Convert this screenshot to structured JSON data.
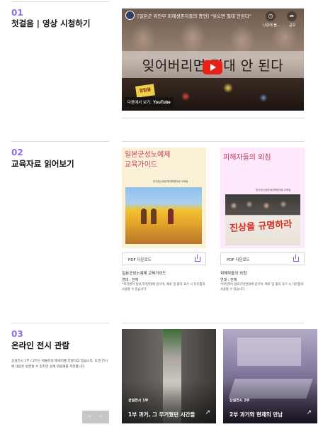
{
  "section1": {
    "number": "01",
    "title": "첫걸음 | 영상 시청하기",
    "video": {
      "title": "[일본군 위안부 피해생존자들의 증언] \"잊으면 절대 안된다\"",
      "overlay_text": "잊어버리면 절대 안 된다",
      "later_label": "나중에 볼...",
      "share_label": "공유",
      "watch_on": "다음에서 보기:",
      "youtube": "YouTube",
      "sign_text": "정말을"
    }
  },
  "section2": {
    "number": "02",
    "title": "교육자료 읽어보기",
    "books": [
      {
        "cover_title": "일본군성노예제\n교육가이드",
        "cover_sub": "한국정신대문제대책협의회 교육팀",
        "pdf_label": "PDF 다운로드",
        "name": "일본군성노예제 교육가이드",
        "meta": "연대 : 전체",
        "note": "*저작권이 정의기억연대에 있으며, 배포 및 출처 표기 시 자유롭게 사용할 수 있습니다."
      },
      {
        "cover_title": "피해자들의 외침",
        "cover_sub": "한국정신대문제대책협의회 교육팀",
        "pdf_label": "PDF 다운로드",
        "name": "피해자들의 외침",
        "meta": "연대 : 전체",
        "note": "*저작권이 정의기억연대에 있으며, 배포 및 출처 표기 시 자유롭게 사용할 수 있습니다.",
        "slogan": "진상을 규명하라"
      }
    ]
  },
  "section3": {
    "number": "03",
    "title": "온라인 전시 관람",
    "description": "상설전시 1부 / 2부는 박물관의 메세지를 전달하고 있습니다. 도면 전시에 대응은 방면할 수 있지만 설계 관람해를 추천합니다.",
    "nav_prev": "‹",
    "nav_next": "›",
    "exhibits": [
      {
        "tag": "상설전시 1부",
        "title": "1부 과거, 그 무거웠던 시간들"
      },
      {
        "tag": "상설전시 2부",
        "title": "2부 과거와 현재의 만남"
      }
    ]
  },
  "icons": {
    "play": "youtube-play-icon",
    "download": "download-icon",
    "arrow": "arrow-up-right-icon"
  },
  "colors": {
    "accent": "#8c6cf0",
    "youtube_red": "#e62117",
    "cover1_bg": "#fbf1d6",
    "cover2_bg": "#fde9fb"
  }
}
